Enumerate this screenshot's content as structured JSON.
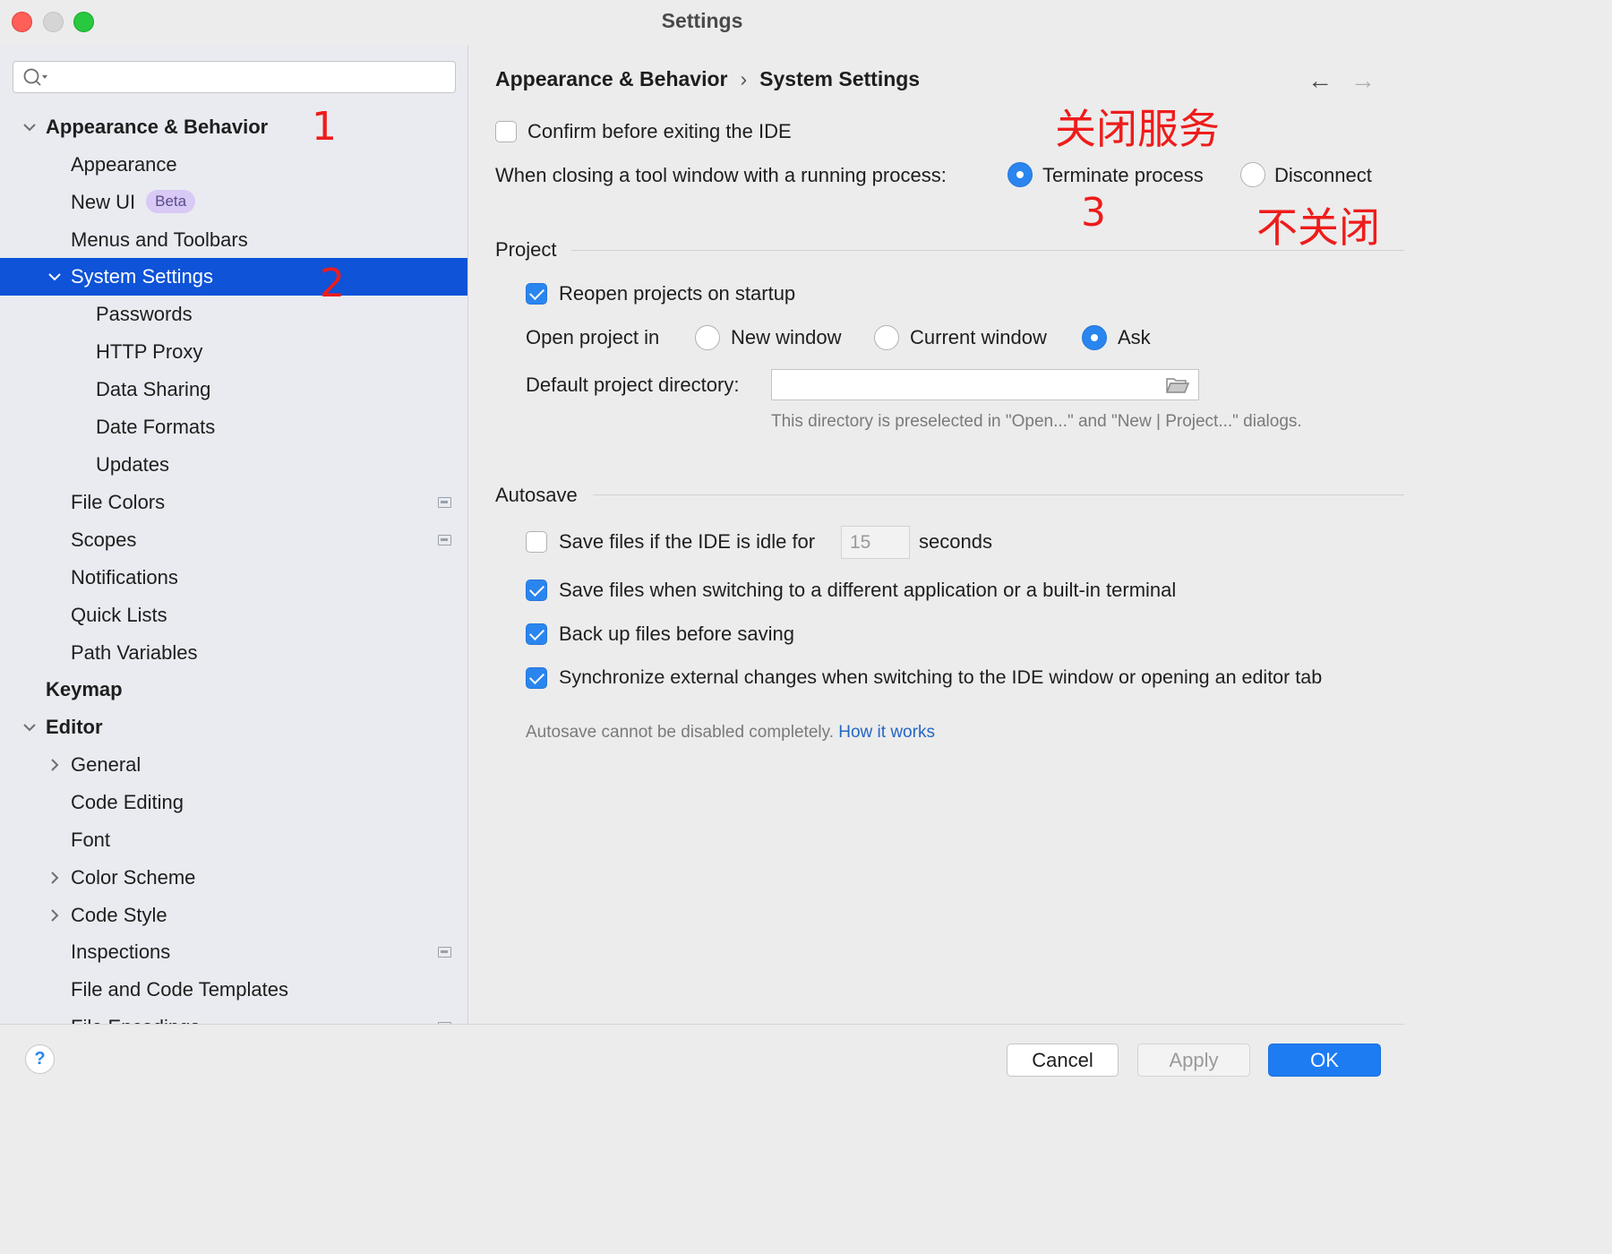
{
  "window": {
    "title": "Settings"
  },
  "sidebar": {
    "items": [
      {
        "label": "Appearance & Behavior",
        "bold": true,
        "expanded": true
      },
      {
        "label": "Appearance"
      },
      {
        "label": "New UI",
        "badge": "Beta"
      },
      {
        "label": "Menus and Toolbars"
      },
      {
        "label": "System Settings",
        "selected": true,
        "expanded": true
      },
      {
        "label": "Passwords"
      },
      {
        "label": "HTTP Proxy"
      },
      {
        "label": "Data Sharing"
      },
      {
        "label": "Date Formats"
      },
      {
        "label": "Updates"
      },
      {
        "label": "File Colors",
        "project_icon": true
      },
      {
        "label": "Scopes",
        "project_icon": true
      },
      {
        "label": "Notifications"
      },
      {
        "label": "Quick Lists"
      },
      {
        "label": "Path Variables"
      },
      {
        "label": "Keymap",
        "bold": true
      },
      {
        "label": "Editor",
        "bold": true,
        "expanded": true
      },
      {
        "label": "General",
        "collapsed": true
      },
      {
        "label": "Code Editing"
      },
      {
        "label": "Font"
      },
      {
        "label": "Color Scheme",
        "collapsed": true
      },
      {
        "label": "Code Style",
        "collapsed": true
      },
      {
        "label": "Inspections",
        "project_icon": true
      },
      {
        "label": "File and Code Templates"
      },
      {
        "label": "File Encodings",
        "project_icon": true
      }
    ]
  },
  "breadcrumb": {
    "parent": "Appearance & Behavior",
    "separator": "›",
    "current": "System Settings"
  },
  "nav": {
    "back": "←",
    "forward": "→"
  },
  "general": {
    "confirm_exit_label": "Confirm before exiting the IDE",
    "confirm_exit_checked": false,
    "closing_label": "When closing a tool window with a running process:",
    "terminate_label": "Terminate process",
    "disconnect_label": "Disconnect",
    "selected_option": "Terminate process"
  },
  "project": {
    "section_title": "Project",
    "reopen_label": "Reopen projects on startup",
    "reopen_checked": true,
    "open_in_label": "Open project in",
    "open_in_options": [
      "New window",
      "Current window",
      "Ask"
    ],
    "open_in_selected": "Ask",
    "default_dir_label": "Default project directory:",
    "default_dir_value": "",
    "default_dir_hint": "This directory is preselected in \"Open...\" and \"New | Project...\" dialogs."
  },
  "autosave": {
    "section_title": "Autosave",
    "idle_label": "Save files if the IDE is idle for",
    "idle_checked": false,
    "idle_seconds": "15",
    "idle_unit": "seconds",
    "switch_label": "Save files when switching to a different application or a built-in terminal",
    "switch_checked": true,
    "backup_label": "Back up files before saving",
    "backup_checked": true,
    "sync_label": "Synchronize external changes when switching to the IDE window or opening an editor tab",
    "sync_checked": true,
    "note": "Autosave cannot be disabled completely.",
    "note_link": "How it works"
  },
  "annotations": {
    "n1": "1",
    "n2": "2",
    "n3": "3",
    "close_service": "关闭服务",
    "dont_close": "不关闭",
    "color": "#ee1c1c"
  },
  "footer": {
    "help": "?",
    "cancel": "Cancel",
    "apply": "Apply",
    "ok": "OK"
  },
  "colors": {
    "accent": "#2a85ee",
    "selection": "#0e53d8",
    "ok_button": "#1e7cf3"
  }
}
